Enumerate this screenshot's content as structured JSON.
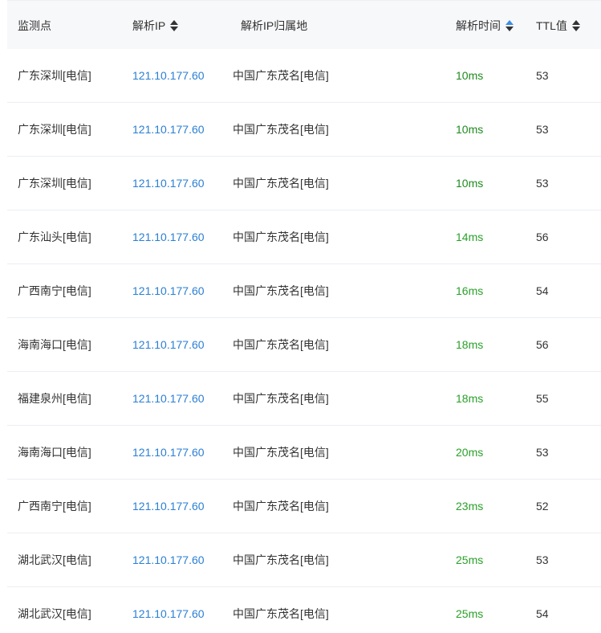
{
  "columns": {
    "monitor": "监测点",
    "ip": "解析IP",
    "location": "解析IP归属地",
    "time": "解析时间",
    "ttl": "TTL值"
  },
  "rows": [
    {
      "monitor": "广东深圳[电信]",
      "ip": "121.10.177.60",
      "location": "中国广东茂名[电信]",
      "time": "10ms",
      "ttl": "53"
    },
    {
      "monitor": "广东深圳[电信]",
      "ip": "121.10.177.60",
      "location": "中国广东茂名[电信]",
      "time": "10ms",
      "ttl": "53"
    },
    {
      "monitor": "广东深圳[电信]",
      "ip": "121.10.177.60",
      "location": "中国广东茂名[电信]",
      "time": "10ms",
      "ttl": "53"
    },
    {
      "monitor": "广东汕头[电信]",
      "ip": "121.10.177.60",
      "location": "中国广东茂名[电信]",
      "time": "14ms",
      "ttl": "56"
    },
    {
      "monitor": "广西南宁[电信]",
      "ip": "121.10.177.60",
      "location": "中国广东茂名[电信]",
      "time": "16ms",
      "ttl": "54"
    },
    {
      "monitor": "海南海口[电信]",
      "ip": "121.10.177.60",
      "location": "中国广东茂名[电信]",
      "time": "18ms",
      "ttl": "56"
    },
    {
      "monitor": "福建泉州[电信]",
      "ip": "121.10.177.60",
      "location": "中国广东茂名[电信]",
      "time": "18ms",
      "ttl": "55"
    },
    {
      "monitor": "海南海口[电信]",
      "ip": "121.10.177.60",
      "location": "中国广东茂名[电信]",
      "time": "20ms",
      "ttl": "53"
    },
    {
      "monitor": "广西南宁[电信]",
      "ip": "121.10.177.60",
      "location": "中国广东茂名[电信]",
      "time": "23ms",
      "ttl": "52"
    },
    {
      "monitor": "湖北武汉[电信]",
      "ip": "121.10.177.60",
      "location": "中国广东茂名[电信]",
      "time": "25ms",
      "ttl": "53"
    },
    {
      "monitor": "湖北武汉[电信]",
      "ip": "121.10.177.60",
      "location": "中国广东茂名[电信]",
      "time": "25ms",
      "ttl": "54"
    }
  ],
  "colors": {
    "ip_link": "#2a7fd4",
    "time_green": "#2aa02a",
    "sort_active": "#3a8ee6"
  }
}
